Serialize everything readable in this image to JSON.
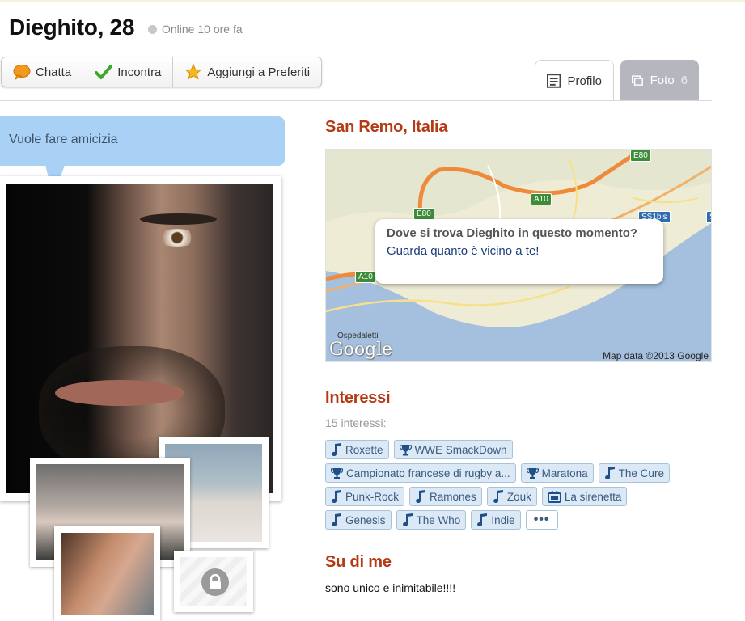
{
  "profile": {
    "name_age": "Dieghito, 28",
    "status": "Online 10 ore fa"
  },
  "actions": [
    {
      "label": "Chatta",
      "icon": "chat-bubble-icon"
    },
    {
      "label": "Incontra",
      "icon": "checkmark-icon"
    },
    {
      "label": "Aggiungi a Preferiti",
      "icon": "star-icon"
    }
  ],
  "tabs": {
    "profile": "Profilo",
    "photos": "Foto",
    "photos_count": "6"
  },
  "intent": "Vuole fare amicizia",
  "location": {
    "title": "San Remo, Italia",
    "popup_question": "Dove si trova Dieghito in questo momento?",
    "popup_link": "Guarda quanto è vicino a te!",
    "map_copyright": "Map data ©2013 Google",
    "map_logo": "Google",
    "labels": [
      "E80",
      "A10",
      "SS1bis",
      "Ospedaletti",
      "E80",
      "A10",
      "S"
    ]
  },
  "interests": {
    "title": "Interessi",
    "count": "15 interessi:",
    "rows": [
      [
        {
          "label": "Roxette",
          "icon": "music-note-icon"
        },
        {
          "label": "WWE SmackDown",
          "icon": "trophy-icon"
        }
      ],
      [
        {
          "label": "Campionato francese di rugby a...",
          "icon": "trophy-icon"
        },
        {
          "label": "Maratona",
          "icon": "trophy-icon"
        },
        {
          "label": "The Cure",
          "icon": "music-note-icon"
        }
      ],
      [
        {
          "label": "Punk-Rock",
          "icon": "music-note-icon"
        },
        {
          "label": "Ramones",
          "icon": "music-note-icon"
        },
        {
          "label": "Zouk",
          "icon": "music-note-icon"
        },
        {
          "label": "La sirenetta",
          "icon": "tv-icon"
        }
      ],
      [
        {
          "label": "Genesis",
          "icon": "music-note-icon"
        },
        {
          "label": "The Who",
          "icon": "music-note-icon"
        },
        {
          "label": "Indie",
          "icon": "music-note-icon"
        }
      ]
    ],
    "more_label": "•••"
  },
  "about": {
    "title": "Su di me",
    "text": "sono unico e inimitabile!!!!"
  },
  "colors": {
    "accent_heading": "#b33a12",
    "bubble": "#a8d1f5",
    "tag_bg": "#dbe9f6",
    "tag_text": "#3b5a7d"
  }
}
